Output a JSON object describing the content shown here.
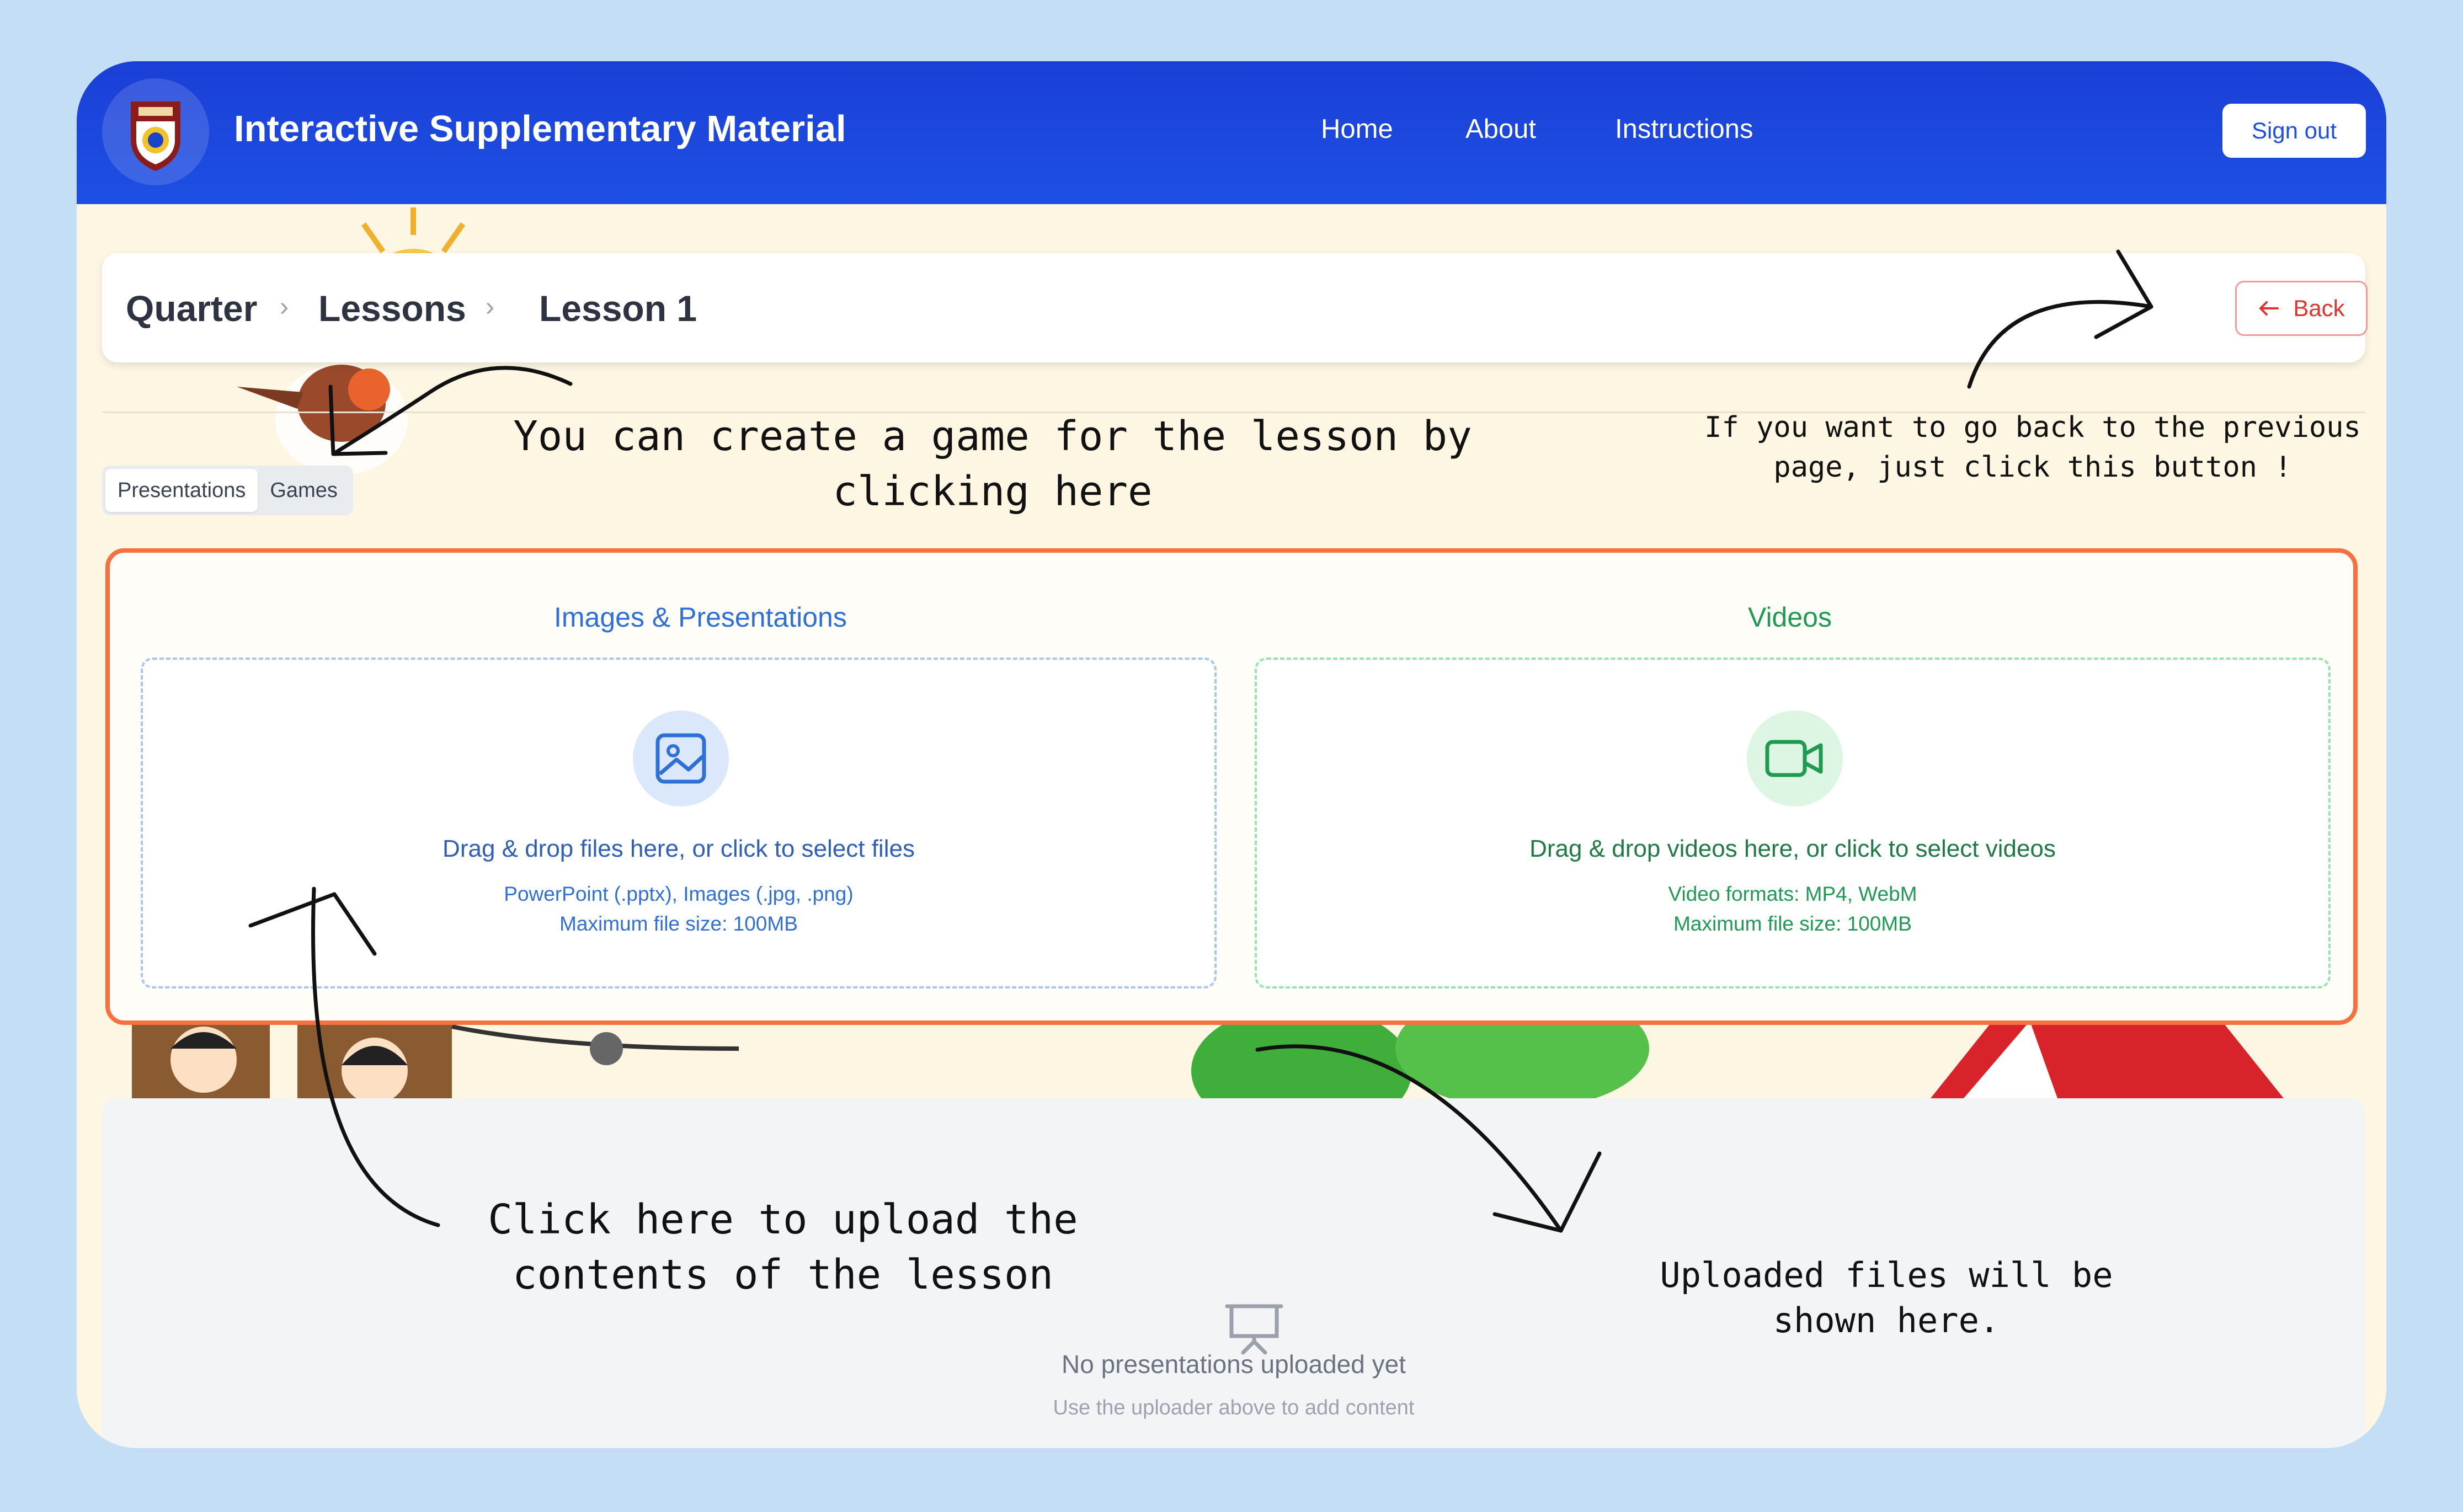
{
  "header": {
    "app_title": "Interactive Supplementary Material",
    "nav": [
      "Home",
      "About",
      "Instructions"
    ],
    "sign_out": "Sign out"
  },
  "breadcrumb": [
    "Quarter",
    "Lessons",
    "Lesson 1"
  ],
  "back_label": "Back",
  "tabs": [
    "Presentations",
    "Games"
  ],
  "upload": {
    "images": {
      "title": "Images & Presentations",
      "main": "Drag & drop files here, or click to select files",
      "formats": "PowerPoint (.pptx), Images (.jpg, .png)",
      "max": "Maximum file size: 100MB"
    },
    "videos": {
      "title": "Videos",
      "main": "Drag & drop videos here, or click to select videos",
      "formats": "Video formats: MP4, WebM",
      "max": "Maximum file size: 100MB"
    }
  },
  "empty_state": {
    "title": "No presentations uploaded yet",
    "subtitle": "Use the uploader above to add content"
  },
  "annotations": {
    "game": "You can create a game for the lesson by clicking here",
    "back": "If you want to go back to the previous page, just click this button !",
    "upload": "Click here to upload the contents of the lesson",
    "files": "Uploaded files will be shown here."
  },
  "colors": {
    "header": "#1e4fe3",
    "page_bg": "#c4dff5",
    "upload_border": "#f5713f",
    "images_accent": "#2f6fd8",
    "videos_accent": "#1f9a52",
    "back_accent": "#e0332b"
  },
  "icons": [
    "school-logo-icon",
    "arrow-left-icon",
    "image-icon",
    "video-camera-icon",
    "presentation-icon"
  ]
}
